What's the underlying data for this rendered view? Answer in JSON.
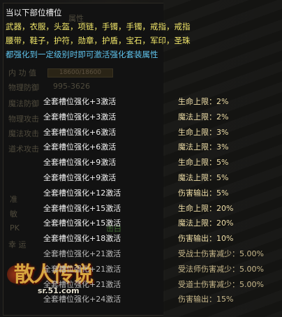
{
  "header": {
    "title": "当以下部位槽位",
    "slots_line1": "武器，衣服，头盔，项链，手镯，手镯，戒指，戒指",
    "slots_line2": "腰带，鞋子，护符，勋章，护盾，宝石，军印，圣珠",
    "note": "都强化到一定级别时即可激活强化套装属性"
  },
  "background": {
    "attr_title": "属性",
    "hp_label": "内 功 值",
    "hp_value": "18600/18600",
    "phys_def_label": "物理防御",
    "phys_def_value": "995-3626",
    "magic_def_label": "魔法防御",
    "phys_atk_label": "物理攻击",
    "magic_atk_label": "魔法攻击",
    "tao_atk_label": "道术攻击",
    "other_label_1": "准",
    "other_label_2": "敏",
    "other_label_3": "PK",
    "other_label_4": "幸 运",
    "green_button": "击白",
    "logo_text": "散人传说",
    "logo_url": "sr.51.com"
  },
  "set_bonuses": [
    {
      "req": "全套槽位强化+3激活",
      "bonus": "生命上限：2%"
    },
    {
      "req": "全套槽位强化+3激活",
      "bonus": "魔法上限：2%"
    },
    {
      "req": "全套槽位强化+6激活",
      "bonus": "生命上限：3%"
    },
    {
      "req": "全套槽位强化+6激活",
      "bonus": "魔法上限：3%"
    },
    {
      "req": "全套槽位强化+9激活",
      "bonus": "生命上限：5%"
    },
    {
      "req": "全套槽位强化+9激活",
      "bonus": "魔法上限：5%"
    },
    {
      "req": "全套槽位强化+12激活",
      "bonus": "伤害输出：5%"
    },
    {
      "req": "全套槽位强化+15激活",
      "bonus": "生命上限：20%"
    },
    {
      "req": "全套槽位强化+15激活",
      "bonus": "魔法上限：20%"
    },
    {
      "req": "全套槽位强化+18激活",
      "bonus": "伤害输出：10%"
    },
    {
      "req": "全套槽位强化+21激活",
      "bonus": "受战士伤害减少：5.00%"
    },
    {
      "req": "全套槽位强化+21激活",
      "bonus": "受法师伤害减少：5.00%"
    },
    {
      "req": "全套槽位强化+21激活",
      "bonus": "受道士伤害减少：5.00%"
    },
    {
      "req": "全套槽位强化+24激活",
      "bonus": "伤害输出：15%"
    }
  ]
}
